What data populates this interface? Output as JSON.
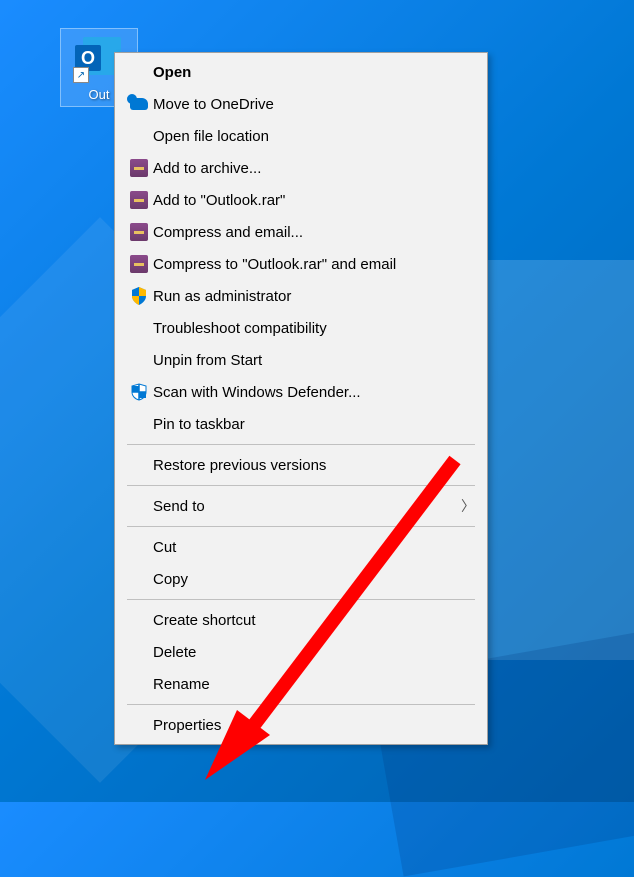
{
  "desktop": {
    "icon_label": "Out",
    "outlook_letter": "O"
  },
  "menu": {
    "items": [
      {
        "label": "Open",
        "icon": null,
        "bold": true
      },
      {
        "label": "Move to OneDrive",
        "icon": "onedrive"
      },
      {
        "label": "Open file location",
        "icon": null
      },
      {
        "label": "Add to archive...",
        "icon": "winrar"
      },
      {
        "label": "Add to \"Outlook.rar\"",
        "icon": "winrar"
      },
      {
        "label": "Compress and email...",
        "icon": "winrar"
      },
      {
        "label": "Compress to \"Outlook.rar\" and email",
        "icon": "winrar"
      },
      {
        "label": "Run as administrator",
        "icon": "uac-shield"
      },
      {
        "label": "Troubleshoot compatibility",
        "icon": null
      },
      {
        "label": "Unpin from Start",
        "icon": null
      },
      {
        "label": "Scan with Windows Defender...",
        "icon": "defender"
      },
      {
        "label": "Pin to taskbar",
        "icon": null
      },
      {
        "sep": true
      },
      {
        "label": "Restore previous versions",
        "icon": null
      },
      {
        "sep": true
      },
      {
        "label": "Send to",
        "icon": null,
        "submenu": true
      },
      {
        "sep": true
      },
      {
        "label": "Cut",
        "icon": null
      },
      {
        "label": "Copy",
        "icon": null
      },
      {
        "sep": true
      },
      {
        "label": "Create shortcut",
        "icon": null
      },
      {
        "label": "Delete",
        "icon": null
      },
      {
        "label": "Rename",
        "icon": null
      },
      {
        "sep": true
      },
      {
        "label": "Properties",
        "icon": null
      }
    ]
  },
  "annotation": {
    "target": "Properties",
    "arrow_color": "#ff0000"
  }
}
